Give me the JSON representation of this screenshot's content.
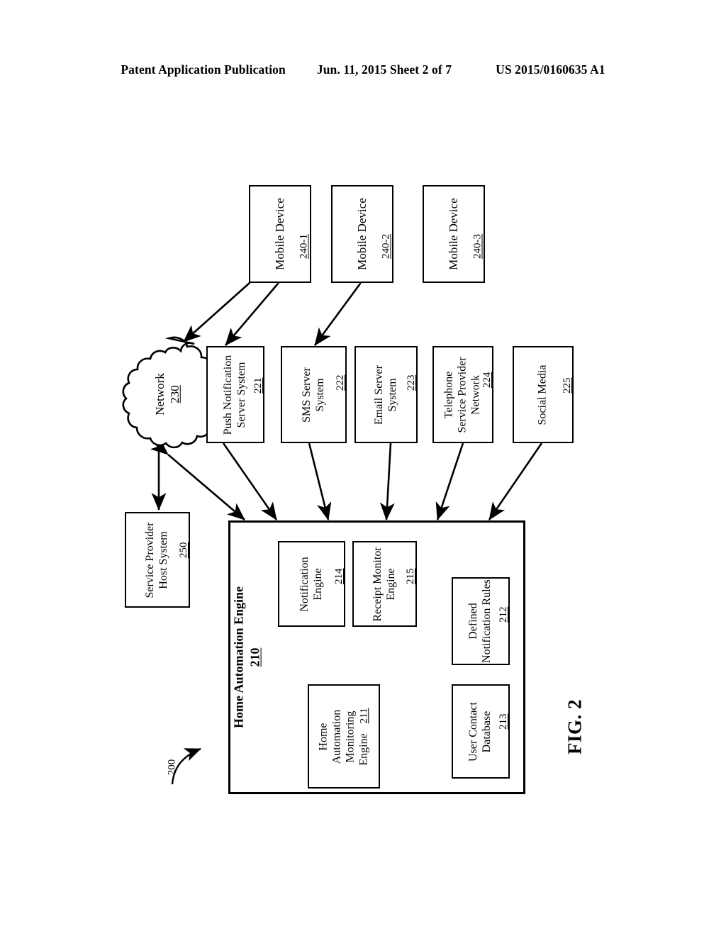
{
  "header": {
    "publication": "Patent Application Publication",
    "date_sheet": "Jun. 11, 2015  Sheet 2 of 7",
    "patent_number": "US 2015/0160635 A1"
  },
  "figure": {
    "label": "FIG. 2",
    "system_callout": "200"
  },
  "mobile_devices": [
    {
      "label": "Mobile Device",
      "ref": "240-1"
    },
    {
      "label": "Mobile Device",
      "ref": "240-2"
    },
    {
      "label": "Mobile Device",
      "ref": "240-3"
    }
  ],
  "network": {
    "label": "Network",
    "ref": "230"
  },
  "service_provider": {
    "line1": "Service Provider",
    "line2": "Host System",
    "ref": "250"
  },
  "services": [
    {
      "line1": "Push Notification",
      "line2": "Server System",
      "ref": "221"
    },
    {
      "line1": "SMS Server",
      "line2": "System",
      "ref": "222"
    },
    {
      "line1": "Email Server",
      "line2": "System",
      "ref": "223"
    },
    {
      "line1": "Telephone",
      "line2": "Service Provider",
      "line3": "Network",
      "ref": "224"
    },
    {
      "line1": "Social Media",
      "line2": "",
      "ref": "225"
    }
  ],
  "engine": {
    "title_line1": "Home Automation Engine",
    "ref": "210",
    "components": [
      {
        "line1": "Notification",
        "line2": "Engine",
        "ref": "214"
      },
      {
        "line1": "Receipt Monitor",
        "line2": "Engine",
        "ref": "215"
      },
      {
        "line1": "Home",
        "line2": "Automation",
        "line3": "Monitoring",
        "line4": "Engine",
        "ref": "211"
      },
      {
        "line1": "Defined",
        "line2": "Notification Rules",
        "ref": "212"
      },
      {
        "line1": "User Contact",
        "line2": "Database",
        "ref": "213"
      }
    ]
  },
  "colors": {
    "ink": "#000000",
    "paper": "#ffffff"
  }
}
